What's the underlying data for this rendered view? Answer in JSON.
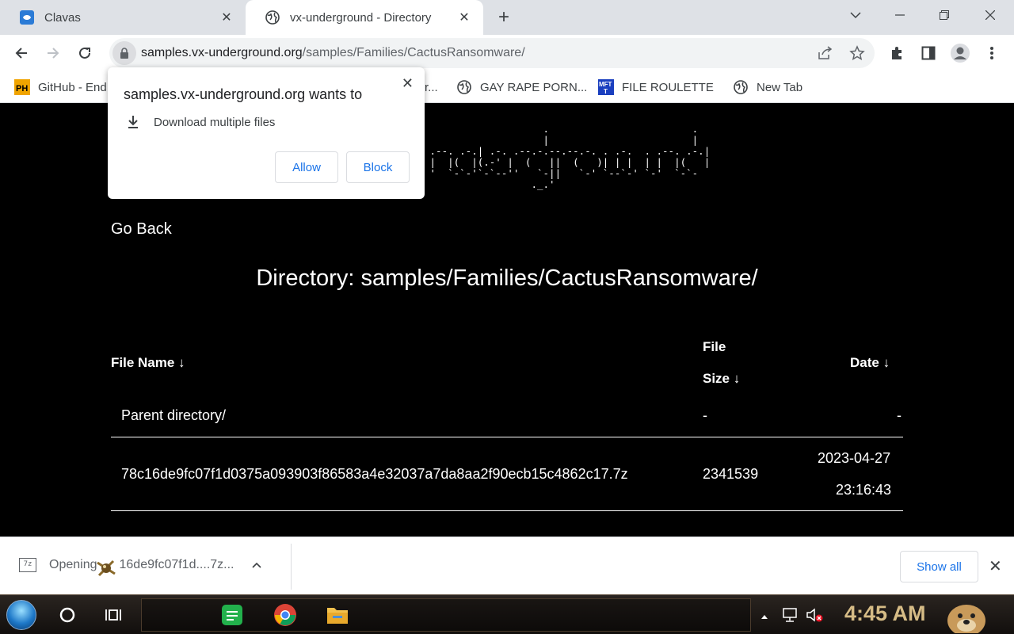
{
  "browser": {
    "tabs": [
      {
        "title": "Clavas",
        "active": false
      },
      {
        "title": "vx-underground - Directory",
        "active": true
      }
    ],
    "address": {
      "host": "samples.vx-underground.org",
      "path": "/samples/Families/CactusRansomware/"
    },
    "bookmarks": [
      {
        "label": "GitHub - End",
        "icon": "ph-logo-icon"
      },
      {
        "label": "r...",
        "icon": "globe-icon"
      },
      {
        "label": "GAY RAPE PORN...",
        "icon": "globe-icon"
      },
      {
        "label": "FILE ROULETTE",
        "icon": "mft-logo-icon"
      },
      {
        "label": "New Tab",
        "icon": "globe-icon"
      }
    ]
  },
  "popup": {
    "title": "samples.vx-underground.org wants to",
    "permission": "Download multiple files",
    "allow_label": "Allow",
    "block_label": "Block"
  },
  "page": {
    "go_back": "Go Back",
    "directory_title": "Directory: samples/Families/CactusRansomware/",
    "columns": {
      "name": "File Name  ↓",
      "size_line1": "File",
      "size_line2": "Size  ↓",
      "date": "Date  ↓"
    },
    "rows": [
      {
        "name": "Parent directory/",
        "size": "-",
        "date": "-",
        "time": ""
      },
      {
        "name": "78c16de9fc07f1d0375a093903f86583a4e32037a7da8aa2f90ecb15c4862c17.7z",
        "size": "2341539",
        "date": "2023-04-27",
        "time": "23:16:43"
      }
    ]
  },
  "downloads": {
    "item_prefix": "Opening",
    "item_name": "16de9fc07f1d....7z...",
    "show_all": "Show all"
  },
  "taskbar": {
    "clock": "4:45 AM"
  },
  "colors": {
    "page_bg": "#000000",
    "tab_strip": "#dee1e6",
    "link_blue": "#1a73e8",
    "clock": "#d6bc86"
  }
}
